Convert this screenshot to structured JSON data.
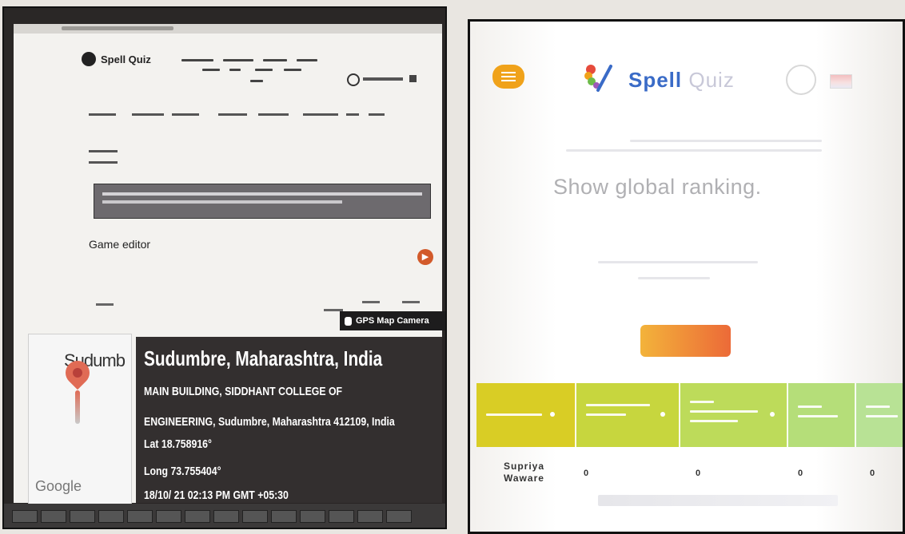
{
  "left_photo": {
    "browser": {
      "brand": "Spell Quiz"
    },
    "editor": {
      "section_title": "Game editor"
    },
    "gps_tag": {
      "label": "GPS Map Camera"
    },
    "map_thumb": {
      "place_partial": "Sudumb",
      "provider": "Google"
    },
    "info": {
      "city": "Sudumbre, Maharashtra, India",
      "address_line1": "MAIN BUILDING, SIDDHANT COLLEGE OF",
      "address_line2": "ENGINEERING, Sudumbre, Maharashtra 412109, India",
      "lat": "Lat 18.758916°",
      "long": "Long 73.755404°",
      "datetime": "18/10/ 21 02:13 PM GMT +05:30"
    }
  },
  "right_photo": {
    "header": {
      "brand_main": "Spell",
      "brand_faded": "Quiz"
    },
    "global_ranking_text": "Show global ranking.",
    "leaderboard": {
      "colors": [
        "#d9cd25",
        "#c7d63e",
        "#bddb5a",
        "#b5de79",
        "#b8e295"
      ],
      "row": {
        "player_first": "Supriya",
        "player_last": "Waware",
        "scores": [
          "0",
          "0",
          "0",
          "0"
        ]
      }
    }
  }
}
